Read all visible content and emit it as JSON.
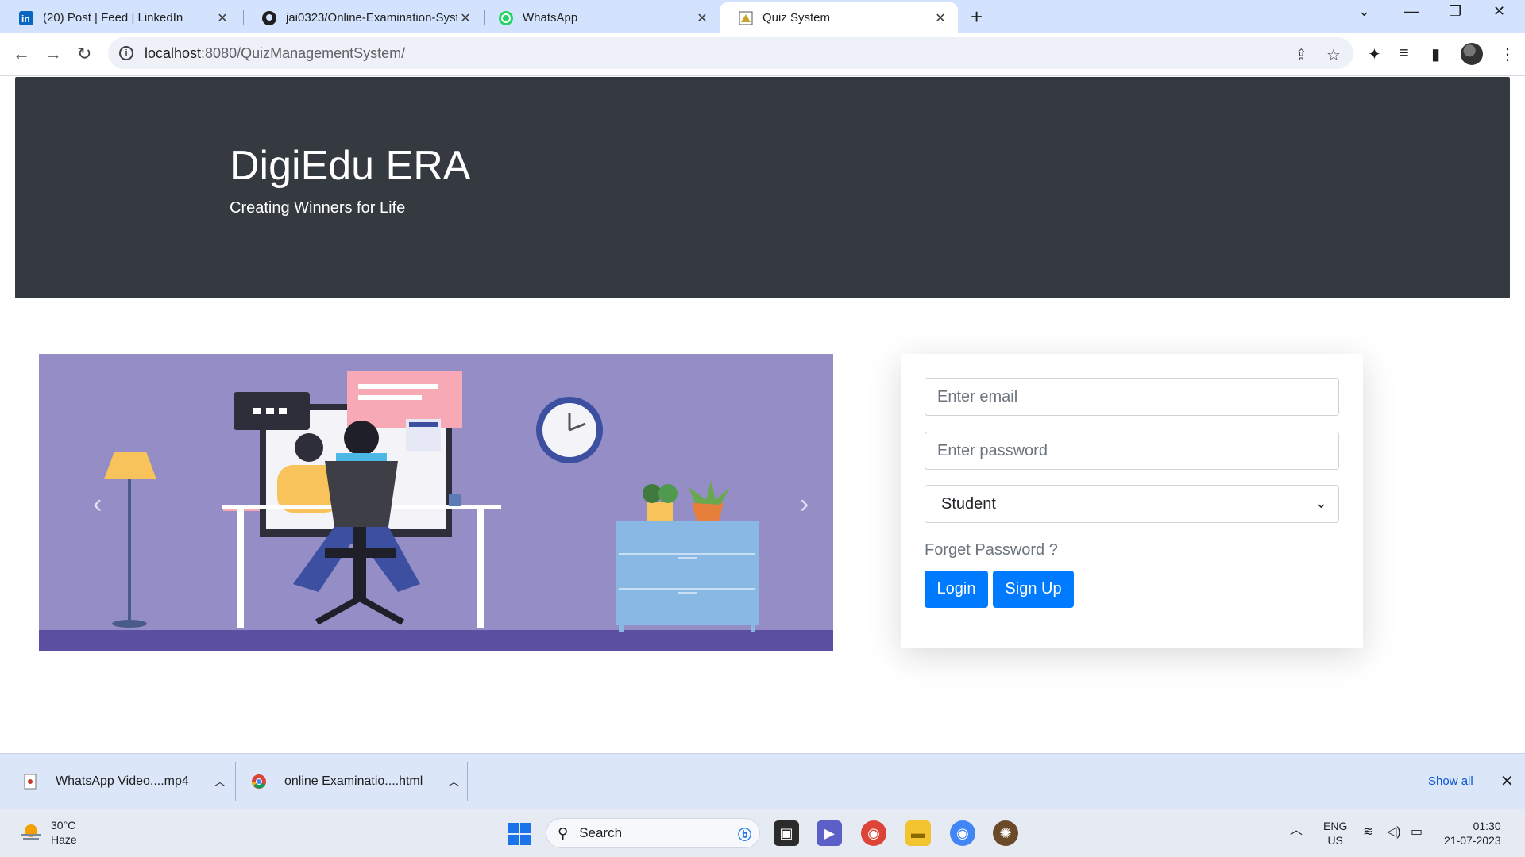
{
  "browser": {
    "tabs": [
      {
        "title": "(20) Post | Feed | LinkedIn",
        "icon": "linkedin-icon"
      },
      {
        "title": "jai0323/Online-Examination-Syst",
        "icon": "github-icon"
      },
      {
        "title": "WhatsApp",
        "icon": "whatsapp-icon"
      },
      {
        "title": "Quiz System",
        "icon": "quiz-favicon-icon",
        "active": true
      }
    ],
    "new_tab": "+",
    "url_host": "localhost",
    "url_path": ":8080/QuizManagementSystem/"
  },
  "hero": {
    "title": "DigiEdu ERA",
    "subtitle": "Creating Winners for Life"
  },
  "carousel": {
    "prev": "‹",
    "next": "›"
  },
  "login": {
    "email_placeholder": "Enter email",
    "password_placeholder": "Enter password",
    "role_selected": "Student",
    "forgot": "Forget Password ?",
    "login_label": "Login",
    "signup_label": "Sign Up",
    "accent": "#007bff"
  },
  "downloads": {
    "items": [
      {
        "name": "WhatsApp Video....mp4"
      },
      {
        "name": "online Examinatio....html"
      }
    ],
    "show_all": "Show all"
  },
  "taskbar": {
    "temp": "30°C",
    "weather": "Haze",
    "search_placeholder": "Search",
    "lang_top": "ENG",
    "lang_bottom": "US",
    "time": "01:30",
    "date": "21-07-2023"
  }
}
